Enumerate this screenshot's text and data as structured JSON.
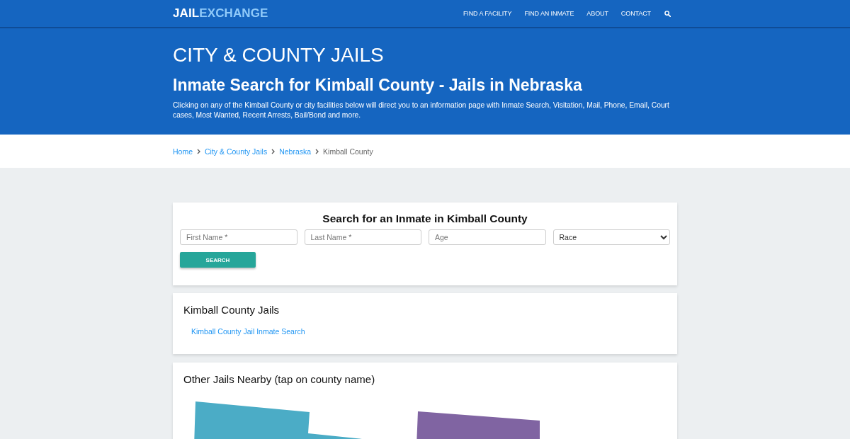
{
  "header": {
    "logo": {
      "first": "JAIL",
      "second": "EXCHANGE"
    },
    "nav": [
      "FIND A FACILITY",
      "FIND AN INMATE",
      "ABOUT",
      "CONTACT"
    ]
  },
  "hero": {
    "kicker": "CITY & COUNTY JAILS",
    "title": "Inmate Search for Kimball County - Jails in Nebraska",
    "intro": "Clicking on any of the Kimball County or city facilities below will direct you to an information page with Inmate Search, Visitation, Mail, Phone, Email, Court cases, Most Wanted, Recent Arrests, Bail/Bond and more."
  },
  "breadcrumb": [
    {
      "label": "Home",
      "kind": "link"
    },
    {
      "label": "City & County Jails",
      "kind": "link"
    },
    {
      "label": "Nebraska",
      "kind": "link"
    },
    {
      "label": "Kimball County",
      "kind": "current"
    }
  ],
  "search_form": {
    "title": "Search for an Inmate in Kimball County",
    "fields": [
      {
        "kind": "input",
        "placeholder": "First Name *"
      },
      {
        "kind": "input",
        "placeholder": "Last Name *"
      },
      {
        "kind": "input",
        "placeholder": "Age"
      },
      {
        "kind": "select",
        "value": "Race"
      }
    ],
    "button": "SEARCH"
  },
  "county_jails": {
    "title": "Kimball County Jails",
    "links": [
      "Kimball County Jail Inmate Search"
    ]
  },
  "nearby": {
    "title": "Other Jails Nearby (tap on county name)",
    "counties": [
      {
        "color": "#4bacc6"
      },
      {
        "color": "#8064a2"
      }
    ]
  }
}
